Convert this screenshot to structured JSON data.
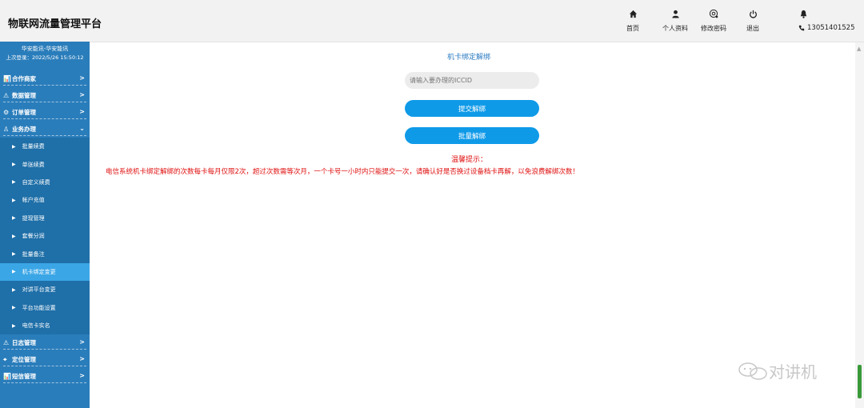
{
  "header": {
    "title": "物联网流量管理平台",
    "nav": [
      {
        "icon": "home-icon",
        "label": "首页"
      },
      {
        "icon": "user-icon",
        "label": "个人资料"
      },
      {
        "icon": "settings-icon",
        "label": "修改密码"
      },
      {
        "icon": "power-icon",
        "label": "退出"
      }
    ],
    "phone": "13051401525"
  },
  "sidebar": {
    "user_name": "华安能讯-华安能讯",
    "last_login": "上次登录：2022/5/26 15:50:12",
    "groups_top": [
      {
        "icon": "chart-icon",
        "label": "合作商家",
        "chev": ">"
      },
      {
        "icon": "warning-icon",
        "label": "数据管理",
        "chev": ">"
      },
      {
        "icon": "gear-icon",
        "label": "订单管理",
        "chev": ">"
      },
      {
        "icon": "user-icon",
        "label": "业务办理",
        "chev": "⌄"
      }
    ],
    "items": [
      "批量续费",
      "单张续费",
      "自定义续费",
      "帐户充值",
      "提现管理",
      "套餐分润",
      "批量备注",
      "机卡绑定变更",
      "对讲平台变更",
      "平台功能设置",
      "电信卡实名"
    ],
    "active_index": 7,
    "groups_bottom": [
      {
        "icon": "warning-icon",
        "label": "日志管理",
        "chev": ">"
      },
      {
        "icon": "locate-icon",
        "label": "定位管理",
        "chev": ">"
      },
      {
        "icon": "chart-icon",
        "label": "短信管理",
        "chev": ">"
      }
    ]
  },
  "main": {
    "title": "机卡绑定解绑",
    "iccid_placeholder": "请输入要办理的ICCID",
    "submit_label": "提交解绑",
    "batch_label": "批量解绑",
    "tip_heading": "温馨提示：",
    "tip_text": "电信系统机卡绑定解绑的次数每卡每月仅限2次，超过次数需等次月，一个卡号一小时内只能提交一次，请确认好是否换过设备档卡再解，以免浪费解绑次数！"
  },
  "watermark": "对讲机",
  "colors": {
    "sidebar": "#2a7dbb",
    "sub_item": "#1f6fa8",
    "active_item": "#3aa6e6",
    "button": "#0f9ae8",
    "warning_text": "#e01010",
    "title_link": "#2b7bc2"
  }
}
